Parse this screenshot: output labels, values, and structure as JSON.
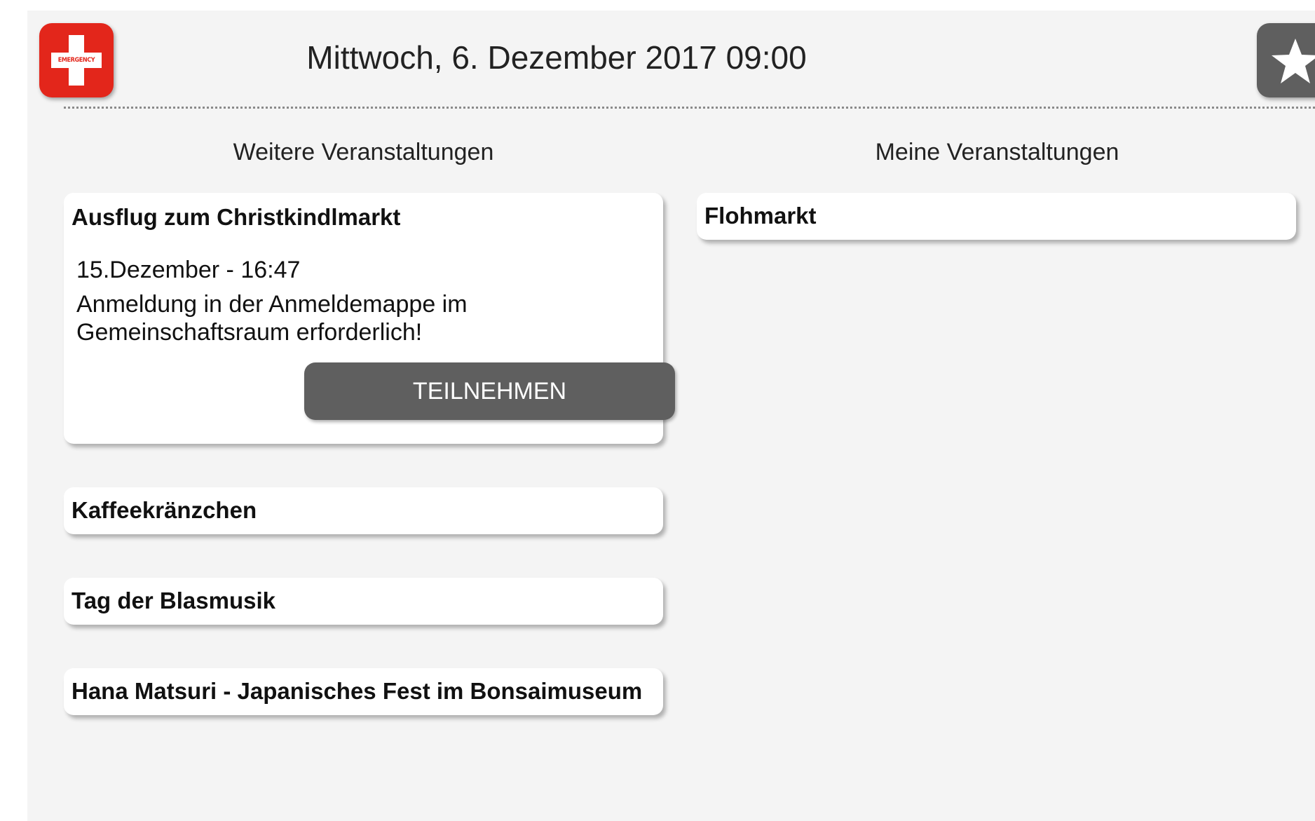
{
  "header": {
    "datetime": "Mittwoch, 6. Dezember 2017 09:00",
    "emergency_label": "EMERGENCY",
    "emergency_icon": "red-cross-icon",
    "favorites_icon": "star-icon"
  },
  "columns": {
    "left_heading": "Weitere Veranstaltungen",
    "right_heading": "Meine Veranstaltungen"
  },
  "other_events": [
    {
      "title": "Ausflug zum Christkindlmarkt",
      "date": "15.Dezember - 16:47",
      "description": "Anmeldung in der Anmeldemappe im Gemeinschaftsraum erforderlich!",
      "button_label": "TEILNEHMEN",
      "expanded": true
    },
    {
      "title": "Kaffeekränzchen"
    },
    {
      "title": "Tag der Blasmusik"
    },
    {
      "title": "Hana Matsuri - Japanisches Fest im Bonsaimuseum"
    }
  ],
  "my_events": [
    {
      "title": "Flohmarkt"
    }
  ],
  "colors": {
    "background": "#f4f4f4",
    "emergency_red": "#e3261b",
    "button_gray": "#5f5f5f",
    "card": "#ffffff"
  }
}
